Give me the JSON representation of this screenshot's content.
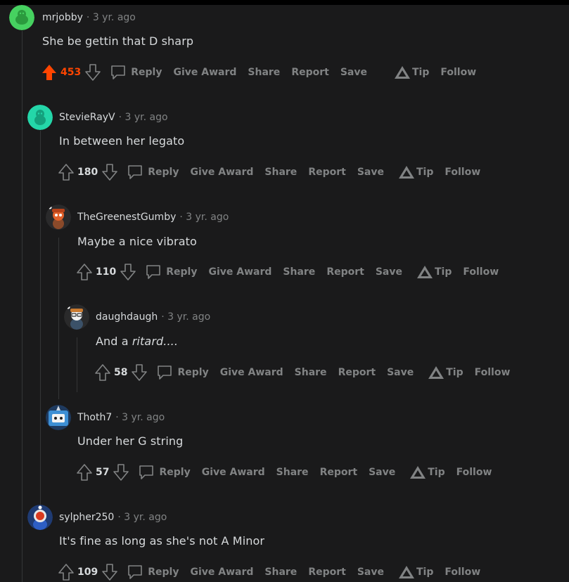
{
  "colors": {
    "background": "#1a1a1b",
    "upvoted": "#ff4500",
    "muted": "#818384",
    "text": "#d7dadc",
    "thread_line": "#343536"
  },
  "labels": {
    "reply": "Reply",
    "give_award": "Give Award",
    "share": "Share",
    "report": "Report",
    "save": "Save",
    "tip": "Tip",
    "follow": "Follow"
  },
  "comments": [
    {
      "username": "mrjobby",
      "age": "· 3 yr. ago",
      "body": "She be gettin that D sharp",
      "score": "453",
      "upvoted": true,
      "avatar": "green-snoo-avatar"
    },
    {
      "username": "StevieRayV",
      "age": "· 3 yr. ago",
      "body": "In between her legato",
      "score": "180",
      "upvoted": false,
      "avatar": "teal-snoo-avatar"
    },
    {
      "username": "TheGreenestGumby",
      "age": "· 3 yr. ago",
      "body": "Maybe a nice vibrato",
      "score": "110",
      "upvoted": false,
      "avatar": "orange-snoo-avatar"
    },
    {
      "username": "daughdaugh",
      "age": "· 3 yr. ago",
      "body_prefix": "And a ",
      "body_italic": "ritard....",
      "score": "58",
      "upvoted": false,
      "avatar": "glasses-snoo-avatar"
    },
    {
      "username": "Thoth7",
      "age": "· 3 yr. ago",
      "body": "Under her G string",
      "score": "57",
      "upvoted": false,
      "avatar": "blue-robot-snoo-avatar"
    },
    {
      "username": "sylpher250",
      "age": "· 3 yr. ago",
      "body": "It's fine as long as she's not A Minor",
      "score": "109",
      "upvoted": false,
      "avatar": "astronaut-snoo-avatar"
    }
  ]
}
